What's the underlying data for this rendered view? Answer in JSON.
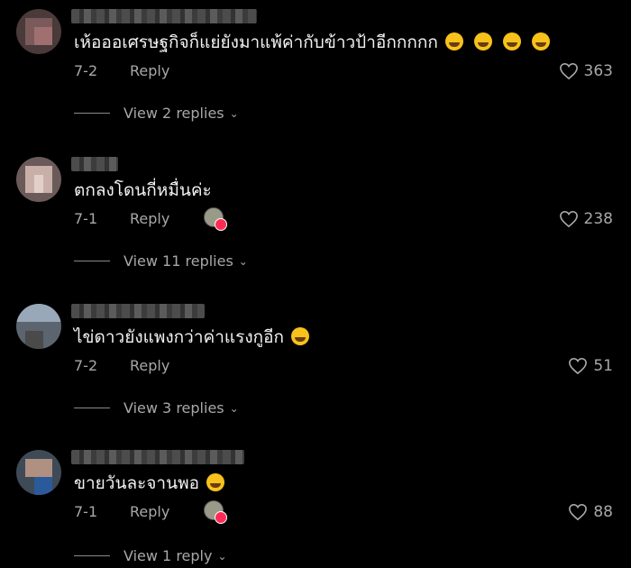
{
  "colors": {
    "background": "#000000",
    "text": "#f2f2f2",
    "muted": "#a8a8a8",
    "like_badge": "#fe2c55"
  },
  "comments": [
    {
      "text": "เห้อออเศรษฐกิจก็แย่ยังมาแพ้ค่ากับข้าวป้าอีกกกกก",
      "emoji": [
        "rofl-emoji",
        "rofl-emoji",
        "rofl-emoji",
        "rofl-emoji"
      ],
      "date": "7-2",
      "reply_label": "Reply",
      "likes": "363",
      "view_replies": "View 2 replies",
      "creator_liked": false
    },
    {
      "text": "ตกลงโดนกี่หมื่นค่ะ",
      "emoji": [],
      "date": "7-1",
      "reply_label": "Reply",
      "likes": "238",
      "view_replies": "View 11 replies",
      "creator_liked": true
    },
    {
      "text": "ไข่ดาวยังแพงกว่าค่าแรงกูอีก",
      "emoji": [
        "grinning-sweat-emoji"
      ],
      "date": "7-2",
      "reply_label": "Reply",
      "likes": "51",
      "view_replies": "View 3 replies",
      "creator_liked": false
    },
    {
      "text": "ขายวันละจานพอ",
      "emoji": [
        "grinning-sweat-emoji"
      ],
      "date": "7-1",
      "reply_label": "Reply",
      "likes": "88",
      "view_replies": "View 1 reply",
      "creator_liked": true
    }
  ]
}
